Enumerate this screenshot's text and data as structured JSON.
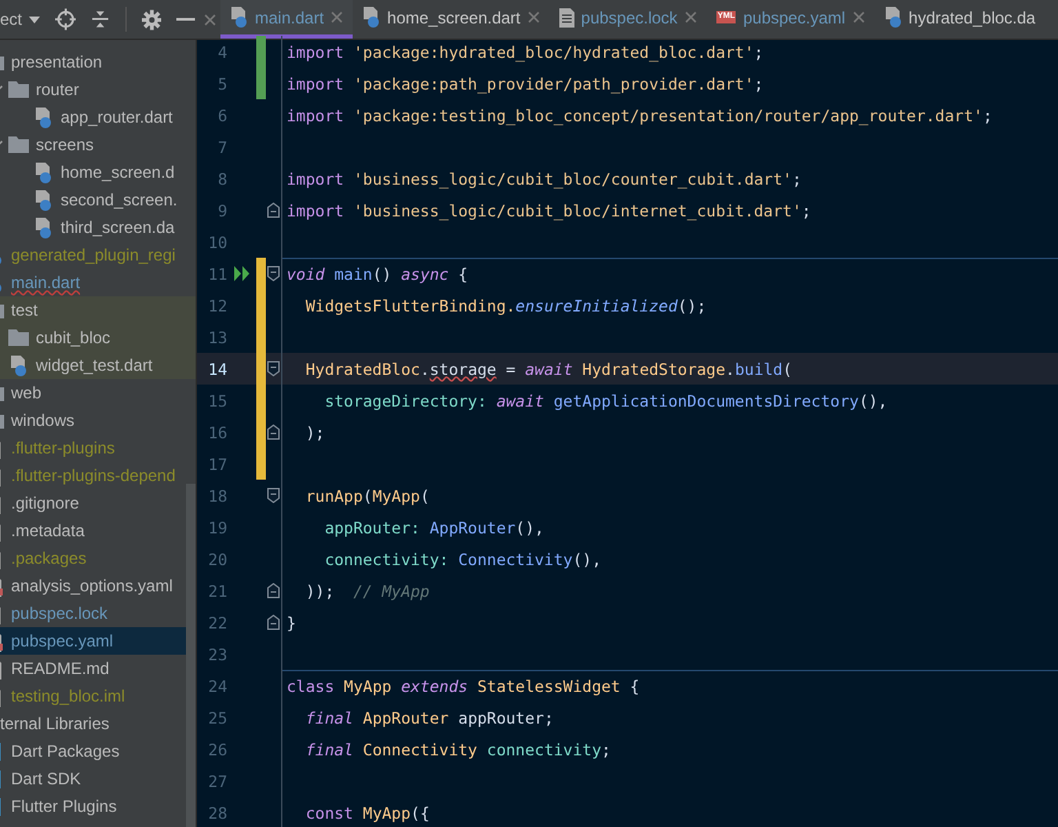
{
  "toolbar": {
    "project_label": "ect"
  },
  "tabs": [
    {
      "label": "main.dart",
      "kind": "dart",
      "modified": true,
      "selected": true
    },
    {
      "label": "home_screen.dart",
      "kind": "dart",
      "modified": false,
      "selected": false
    },
    {
      "label": "pubspec.lock",
      "kind": "text",
      "modified": true,
      "selected": false
    },
    {
      "label": "pubspec.yaml",
      "kind": "yaml",
      "badge": "YML",
      "modified": true,
      "selected": false
    },
    {
      "label": "hydrated_bloc.da",
      "kind": "dart",
      "modified": false,
      "selected": false
    }
  ],
  "project_tree": [
    {
      "name": "presentation",
      "kind": "folder",
      "ignored": false,
      "modified": false,
      "error": false,
      "selected": false,
      "children": [
        {
          "name": "router",
          "kind": "folder",
          "ignored": false,
          "modified": false,
          "error": false,
          "expanded": true,
          "selected": false,
          "children": [
            {
              "name": "app_router.dart",
              "kind": "dart",
              "ignored": false,
              "modified": false,
              "error": false,
              "selected": false
            }
          ]
        },
        {
          "name": "screens",
          "kind": "folder",
          "ignored": false,
          "modified": false,
          "error": false,
          "expanded": true,
          "selected": false,
          "children": [
            {
              "name": "home_screen.d",
              "kind": "dart",
              "ignored": false,
              "modified": false,
              "error": false,
              "selected": false
            },
            {
              "name": "second_screen.",
              "kind": "dart",
              "ignored": false,
              "modified": false,
              "error": false,
              "selected": false
            },
            {
              "name": "third_screen.da",
              "kind": "dart",
              "ignored": false,
              "modified": false,
              "error": false,
              "selected": false
            }
          ]
        }
      ]
    },
    {
      "name": "generated_plugin_regi",
      "kind": "dart",
      "ignored": true,
      "modified": false,
      "error": false,
      "selected": false
    },
    {
      "name": "main.dart",
      "kind": "dart",
      "ignored": false,
      "modified": true,
      "error": true,
      "selected": false
    },
    {
      "name": "test",
      "kind": "test_folder",
      "ignored": false,
      "modified": false,
      "error": false,
      "selected": false,
      "children": [
        {
          "name": "cubit_bloc",
          "kind": "folder",
          "ignored": false,
          "modified": false,
          "error": false,
          "selected": false
        },
        {
          "name": "widget_test.dart",
          "kind": "dart",
          "ignored": false,
          "modified": false,
          "error": false,
          "selected": false
        }
      ]
    },
    {
      "name": "web",
      "kind": "folder",
      "ignored": false,
      "modified": false,
      "error": false,
      "selected": false
    },
    {
      "name": "windows",
      "kind": "folder",
      "ignored": false,
      "modified": false,
      "error": false,
      "selected": false
    },
    {
      "name": ".flutter-plugins",
      "kind": "file",
      "ignored": true,
      "modified": false,
      "error": false,
      "selected": false
    },
    {
      "name": ".flutter-plugins-depend",
      "kind": "file",
      "ignored": true,
      "modified": false,
      "error": false,
      "selected": false
    },
    {
      "name": ".gitignore",
      "kind": "file",
      "ignored": false,
      "modified": false,
      "error": false,
      "selected": false
    },
    {
      "name": ".metadata",
      "kind": "file",
      "ignored": false,
      "modified": false,
      "error": false,
      "selected": false
    },
    {
      "name": ".packages",
      "kind": "file",
      "ignored": true,
      "modified": false,
      "error": false,
      "selected": false
    },
    {
      "name": "analysis_options.yaml",
      "kind": "yaml",
      "ignored": false,
      "modified": false,
      "error": false,
      "selected": false
    },
    {
      "name": "pubspec.lock",
      "kind": "file",
      "ignored": false,
      "modified": true,
      "error": false,
      "selected": false
    },
    {
      "name": "pubspec.yaml",
      "kind": "yaml",
      "ignored": false,
      "modified": true,
      "error": false,
      "selected": true
    },
    {
      "name": "README.md",
      "kind": "markdown",
      "ignored": false,
      "modified": false,
      "error": false,
      "selected": false
    },
    {
      "name": "testing_bloc.iml",
      "kind": "file",
      "ignored": true,
      "modified": false,
      "error": false,
      "selected": false
    },
    {
      "name": "ternal Libraries",
      "kind": "group",
      "ignored": false,
      "modified": false,
      "error": false,
      "selected": false,
      "children": [
        {
          "name": "Dart Packages",
          "kind": "library",
          "ignored": false,
          "modified": false,
          "error": false,
          "selected": false
        },
        {
          "name": "Dart SDK",
          "kind": "library",
          "ignored": false,
          "modified": false,
          "error": false,
          "selected": false
        },
        {
          "name": "Flutter Plugins",
          "kind": "library",
          "ignored": false,
          "modified": false,
          "error": false,
          "selected": false
        }
      ]
    }
  ],
  "code_lines": [
    {
      "number": "4",
      "added": true,
      "changed": false,
      "fold_start": false,
      "fold_end": false,
      "run": false,
      "current": false,
      "separator": false,
      "tokens": [
        {
          "text": "import ",
          "kind": "kw"
        },
        {
          "text": "'package:hydrated_bloc/hydrated_bloc.dart'",
          "kind": "str"
        },
        {
          "text": ";",
          "kind": "plain"
        }
      ]
    },
    {
      "number": "5",
      "added": true,
      "changed": false,
      "fold_start": false,
      "fold_end": false,
      "run": false,
      "current": false,
      "separator": false,
      "tokens": [
        {
          "text": "import ",
          "kind": "kw"
        },
        {
          "text": "'package:path_provider/path_provider.dart'",
          "kind": "str"
        },
        {
          "text": ";",
          "kind": "plain"
        }
      ]
    },
    {
      "number": "6",
      "added": false,
      "changed": false,
      "fold_start": false,
      "fold_end": false,
      "run": false,
      "current": false,
      "separator": false,
      "tokens": [
        {
          "text": "import ",
          "kind": "kw"
        },
        {
          "text": "'package:testing_bloc_concept/presentation/router/app_router.dart'",
          "kind": "str"
        },
        {
          "text": ";",
          "kind": "plain"
        }
      ]
    },
    {
      "number": "7",
      "added": false,
      "changed": false,
      "fold_start": false,
      "fold_end": false,
      "run": false,
      "current": false,
      "separator": false
    },
    {
      "number": "8",
      "added": false,
      "changed": false,
      "fold_start": false,
      "fold_end": false,
      "run": false,
      "current": false,
      "separator": false,
      "tokens": [
        {
          "text": "import ",
          "kind": "kw"
        },
        {
          "text": "'business_logic/cubit_bloc/counter_cubit.dart'",
          "kind": "str"
        },
        {
          "text": ";",
          "kind": "plain"
        }
      ]
    },
    {
      "number": "9",
      "added": false,
      "changed": false,
      "fold_start": false,
      "fold_end": true,
      "run": false,
      "current": false,
      "separator": false,
      "tokens": [
        {
          "text": "import ",
          "kind": "kw"
        },
        {
          "text": "'business_logic/cubit_bloc/internet_cubit.dart'",
          "kind": "str"
        },
        {
          "text": ";",
          "kind": "plain"
        }
      ]
    },
    {
      "number": "10",
      "added": false,
      "changed": false,
      "fold_start": false,
      "fold_end": false,
      "run": false,
      "current": false,
      "separator": false
    },
    {
      "number": "11",
      "added": false,
      "changed": true,
      "fold_start": true,
      "fold_end": false,
      "run": true,
      "current": false,
      "separator": true,
      "tokens": [
        {
          "text": "void ",
          "kind": "kwi"
        },
        {
          "text": "main",
          "kind": "fn"
        },
        {
          "text": "() ",
          "kind": "plain"
        },
        {
          "text": "async ",
          "kind": "kwi"
        },
        {
          "text": "{",
          "kind": "plain"
        }
      ]
    },
    {
      "number": "12",
      "added": false,
      "changed": true,
      "fold_start": false,
      "fold_end": false,
      "run": false,
      "current": false,
      "separator": false,
      "tokens": [
        {
          "text": "  WidgetsFlutterBinding.",
          "kind": "cls"
        },
        {
          "text": "ensureInitialized",
          "kind": "fni"
        },
        {
          "text": "();",
          "kind": "plain"
        }
      ]
    },
    {
      "number": "13",
      "added": false,
      "changed": true,
      "fold_start": false,
      "fold_end": false,
      "run": false,
      "current": false,
      "separator": false
    },
    {
      "number": "14",
      "added": false,
      "changed": true,
      "fold_start": true,
      "fold_end": false,
      "run": false,
      "current": true,
      "separator": false,
      "tokens": [
        {
          "text": "  HydratedBloc",
          "kind": "cls"
        },
        {
          "text": ".",
          "kind": "plain"
        },
        {
          "text": "storage",
          "kind": "warn"
        },
        {
          "text": " = ",
          "kind": "plain"
        },
        {
          "text": "await ",
          "kind": "kwi"
        },
        {
          "text": "HydratedStorage",
          "kind": "cls"
        },
        {
          "text": ".",
          "kind": "plain"
        },
        {
          "text": "build",
          "kind": "fn"
        },
        {
          "text": "(",
          "kind": "plain"
        }
      ]
    },
    {
      "number": "15",
      "added": false,
      "changed": true,
      "fold_start": false,
      "fold_end": false,
      "run": false,
      "current": false,
      "separator": false,
      "tokens": [
        {
          "text": "    storageDirectory: ",
          "kind": "param"
        },
        {
          "text": "await ",
          "kind": "kwi"
        },
        {
          "text": "getApplicationDocumentsDirectory",
          "kind": "fn"
        },
        {
          "text": "(),",
          "kind": "plain"
        }
      ]
    },
    {
      "number": "16",
      "added": false,
      "changed": true,
      "fold_start": false,
      "fold_end": true,
      "run": false,
      "current": false,
      "separator": false,
      "tokens": [
        {
          "text": "  );",
          "kind": "plain"
        }
      ]
    },
    {
      "number": "17",
      "added": false,
      "changed": true,
      "fold_start": false,
      "fold_end": false,
      "run": false,
      "current": false,
      "separator": false
    },
    {
      "number": "18",
      "added": false,
      "changed": false,
      "fold_start": true,
      "fold_end": false,
      "run": false,
      "current": false,
      "separator": false,
      "tokens": [
        {
          "text": "  runApp",
          "kind": "cls"
        },
        {
          "text": "(",
          "kind": "plain"
        },
        {
          "text": "MyApp",
          "kind": "cls"
        },
        {
          "text": "(",
          "kind": "plain"
        }
      ]
    },
    {
      "number": "19",
      "added": false,
      "changed": false,
      "fold_start": false,
      "fold_end": false,
      "run": false,
      "current": false,
      "separator": false,
      "tokens": [
        {
          "text": "    appRouter: ",
          "kind": "param"
        },
        {
          "text": "AppRouter",
          "kind": "fn"
        },
        {
          "text": "(),",
          "kind": "plain"
        }
      ]
    },
    {
      "number": "20",
      "added": false,
      "changed": false,
      "fold_start": false,
      "fold_end": false,
      "run": false,
      "current": false,
      "separator": false,
      "tokens": [
        {
          "text": "    connectivity: ",
          "kind": "param"
        },
        {
          "text": "Connectivity",
          "kind": "fn"
        },
        {
          "text": "(),",
          "kind": "plain"
        }
      ]
    },
    {
      "number": "21",
      "added": false,
      "changed": false,
      "fold_start": false,
      "fold_end": true,
      "run": false,
      "current": false,
      "separator": false,
      "tokens": [
        {
          "text": "  ));  ",
          "kind": "plain"
        },
        {
          "text": "// MyApp",
          "kind": "comment"
        }
      ]
    },
    {
      "number": "22",
      "added": false,
      "changed": false,
      "fold_start": false,
      "fold_end": true,
      "run": false,
      "current": false,
      "separator": false,
      "tokens": [
        {
          "text": "}",
          "kind": "plain"
        }
      ]
    },
    {
      "number": "23",
      "added": false,
      "changed": false,
      "fold_start": false,
      "fold_end": false,
      "run": false,
      "current": false,
      "separator": false
    },
    {
      "number": "24",
      "added": false,
      "changed": false,
      "fold_start": false,
      "fold_end": false,
      "run": false,
      "current": false,
      "separator": true,
      "tokens": [
        {
          "text": "class ",
          "kind": "kw"
        },
        {
          "text": "MyApp ",
          "kind": "cls"
        },
        {
          "text": "extends ",
          "kind": "kwi"
        },
        {
          "text": "StatelessWidget ",
          "kind": "cls"
        },
        {
          "text": "{",
          "kind": "plain"
        }
      ]
    },
    {
      "number": "25",
      "added": false,
      "changed": false,
      "fold_start": false,
      "fold_end": false,
      "run": false,
      "current": false,
      "separator": false,
      "tokens": [
        {
          "text": "  final ",
          "kind": "kwi"
        },
        {
          "text": "AppRouter ",
          "kind": "cls"
        },
        {
          "text": "appRouter;",
          "kind": "plain"
        }
      ]
    },
    {
      "number": "26",
      "added": false,
      "changed": false,
      "fold_start": false,
      "fold_end": false,
      "run": false,
      "current": false,
      "separator": false,
      "tokens": [
        {
          "text": "  final ",
          "kind": "kwi"
        },
        {
          "text": "Connectivity ",
          "kind": "cls"
        },
        {
          "text": "connectivity",
          "kind": "param"
        },
        {
          "text": ";",
          "kind": "plain"
        }
      ]
    },
    {
      "number": "27",
      "added": false,
      "changed": false,
      "fold_start": false,
      "fold_end": false,
      "run": false,
      "current": false,
      "separator": false
    },
    {
      "number": "28",
      "added": false,
      "changed": false,
      "fold_start": false,
      "fold_end": false,
      "run": false,
      "current": false,
      "separator": false,
      "tokens": [
        {
          "text": "  const ",
          "kind": "kw"
        },
        {
          "text": "MyApp",
          "kind": "cls"
        },
        {
          "text": "({",
          "kind": "plain"
        }
      ]
    }
  ]
}
